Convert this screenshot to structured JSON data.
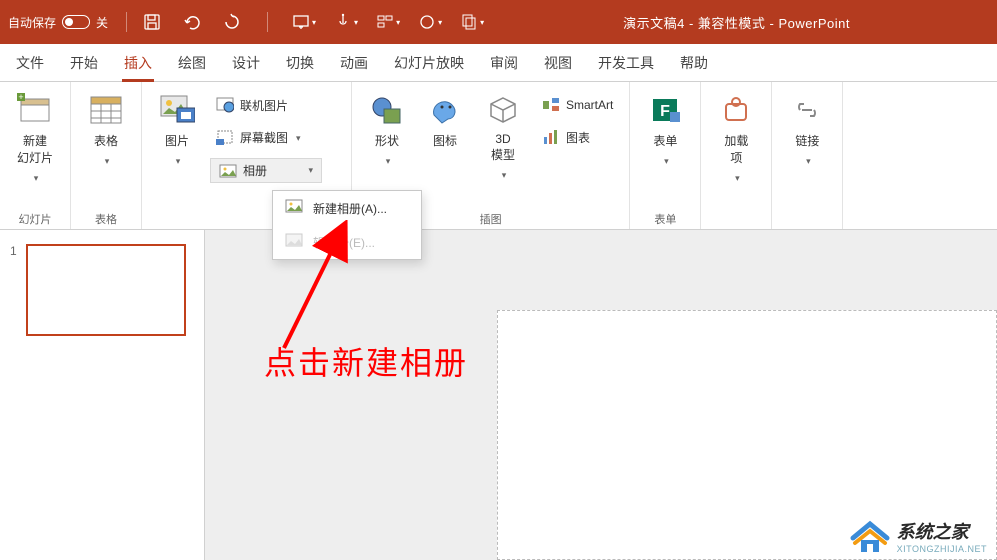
{
  "titlebar": {
    "autosave_label": "自动保存",
    "autosave_state": "关",
    "title": "演示文稿4 - 兼容性模式 - PowerPoint"
  },
  "tabs": [
    "文件",
    "开始",
    "插入",
    "绘图",
    "设计",
    "切换",
    "动画",
    "幻灯片放映",
    "审阅",
    "视图",
    "开发工具",
    "帮助"
  ],
  "active_tab_index": 2,
  "ribbon": {
    "groups": {
      "slides": {
        "label": "幻灯片",
        "new_slide": "新建\n幻灯片"
      },
      "tables": {
        "label": "表格",
        "table": "表格"
      },
      "images": {
        "picture": "图片",
        "online": "联机图片",
        "screenshot": "屏幕截图",
        "album": "相册"
      },
      "illustrations": {
        "label": "插图",
        "shapes": "形状",
        "icons": "图标",
        "models3d": "3D\n模型",
        "smartart": "SmartArt",
        "chart": "图表"
      },
      "forms": {
        "label": "表单",
        "form": "表单"
      },
      "addins": {
        "addin": "加载\n项"
      },
      "links": {
        "link": "链接"
      }
    }
  },
  "dropdown": {
    "new_album": "新建相册(A)...",
    "edit_album": "辑相册(E)..."
  },
  "slide_panel": {
    "current": "1"
  },
  "annotation": {
    "text": "点击新建相册"
  },
  "watermark": {
    "main": "系统之家",
    "sub": "XITONGZHIJIA.NET"
  },
  "colors": {
    "brand": "#B43B1F",
    "annot": "#FF0000",
    "wm_blue": "#3A8BD8"
  }
}
